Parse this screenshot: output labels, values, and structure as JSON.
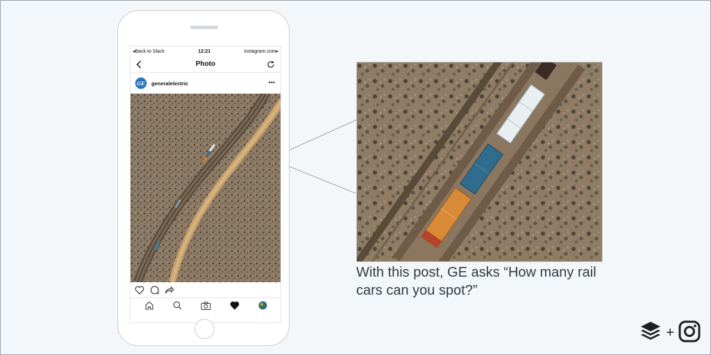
{
  "status_bar": {
    "back_label": "Back to Slack",
    "time": "12:21",
    "site": "instagram.com"
  },
  "nav_bar": {
    "title": "Photo"
  },
  "post": {
    "username": "generalelectric",
    "avatar_text": "GE",
    "more_icon": "•••"
  },
  "caption": "With this post, GE asks “How many rail cars can you spot?”",
  "brand": {
    "plus": "+"
  },
  "colors": {
    "background": "#f3f7f9",
    "caption_text": "#333a3f",
    "ge_blue": "#1f74b7",
    "terrain": "#8c7a63",
    "dirt_road": "#c59a5e"
  },
  "icons": {
    "nav_back": "chevron-left-icon",
    "nav_refresh": "refresh-icon",
    "like": "heart-outline-icon",
    "comment": "comment-icon",
    "share": "share-arrow-icon",
    "tab_home": "home-icon",
    "tab_search": "search-icon",
    "tab_camera": "camera-icon",
    "tab_activity": "heart-filled-icon",
    "tab_profile": "profile-avatar-icon",
    "buffer_logo": "buffer-stack-icon",
    "instagram_logo": "instagram-icon"
  }
}
